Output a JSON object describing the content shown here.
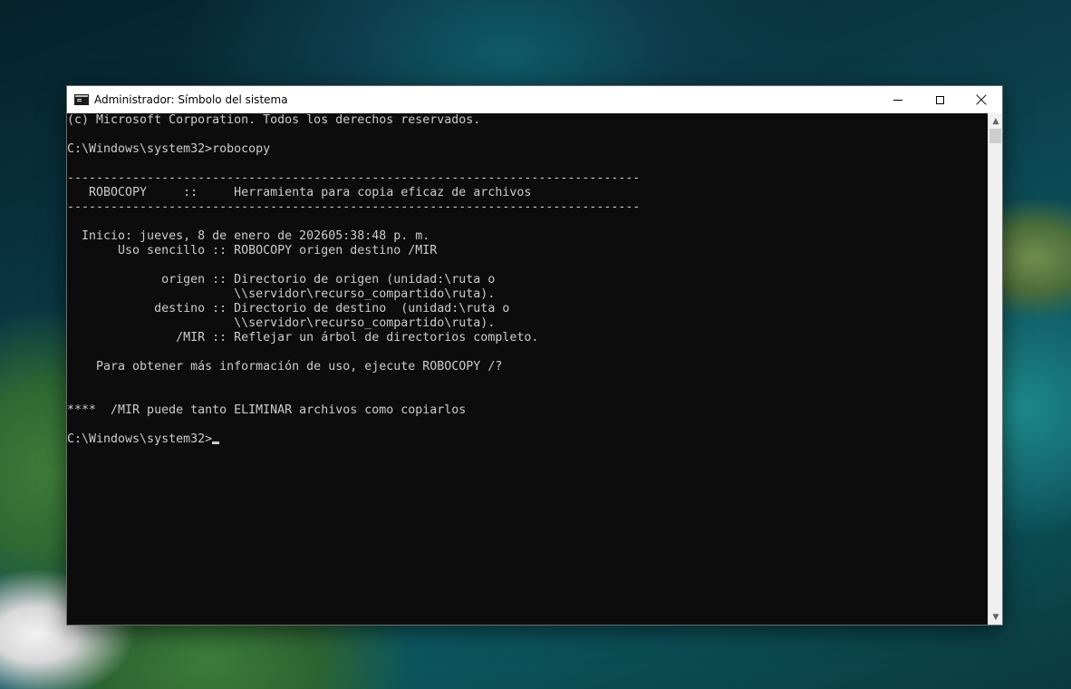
{
  "window": {
    "title": "Administrador: Símbolo del sistema",
    "icon": "cmd-icon",
    "buttons": {
      "minimize": "minimize-icon",
      "maximize": "maximize-icon",
      "close": "close-icon"
    }
  },
  "console": {
    "lines": [
      "(c) Microsoft Corporation. Todos los derechos reservados.",
      "",
      "C:\\Windows\\system32>robocopy",
      "",
      "-------------------------------------------------------------------------------",
      "   ROBOCOPY     ::     Herramienta para copia eficaz de archivos",
      "-------------------------------------------------------------------------------",
      "",
      "  Inicio: jueves, 8 de enero de 202605:38:48 p. m.",
      "       Uso sencillo :: ROBOCOPY origen destino /MIR",
      "",
      "             origen :: Directorio de origen (unidad:\\ruta o",
      "                       \\\\servidor\\recurso_compartido\\ruta).",
      "            destino :: Directorio de destino  (unidad:\\ruta o",
      "                       \\\\servidor\\recurso_compartido\\ruta).",
      "               /MIR :: Reflejar un árbol de directorios completo.",
      "",
      "    Para obtener más información de uso, ejecute ROBOCOPY /?",
      "",
      "",
      "****  /MIR puede tanto ELIMINAR archivos como copiarlos",
      "",
      "C:\\Windows\\system32>"
    ]
  },
  "colors": {
    "console_background": "#0c0c0c",
    "console_text": "#cccccc",
    "titlebar_background": "#ffffff"
  }
}
